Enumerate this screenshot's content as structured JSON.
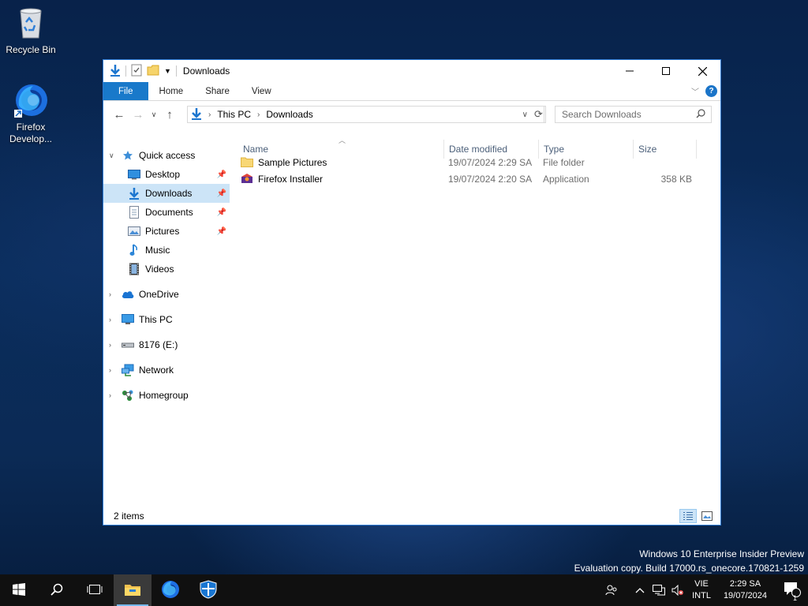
{
  "desktop": {
    "icons": [
      {
        "label": "Recycle Bin",
        "icon": "recycle-bin-icon"
      },
      {
        "label": "Firefox Develop...",
        "label_lines": [
          "Firefox",
          "Develop..."
        ],
        "icon": "firefox-developer-icon"
      }
    ],
    "watermark": {
      "line1": "Windows 10 Enterprise Insider Preview",
      "line2": "Evaluation copy. Build 17000.rs_onecore.170821-1259"
    }
  },
  "window": {
    "title": "Downloads",
    "ribbon_tabs": [
      "File",
      "Home",
      "Share",
      "View"
    ],
    "breadcrumb": [
      "This PC",
      "Downloads"
    ],
    "search_placeholder": "Search Downloads",
    "accent_color": "#1979ca",
    "sidebar": {
      "quick_access": "Quick access",
      "quick_items": [
        {
          "label": "Desktop",
          "icon": "desktop-icon",
          "pinned": true
        },
        {
          "label": "Downloads",
          "icon": "downloads-icon",
          "pinned": true,
          "selected": true
        },
        {
          "label": "Documents",
          "icon": "documents-icon",
          "pinned": true
        },
        {
          "label": "Pictures",
          "icon": "pictures-icon",
          "pinned": true
        },
        {
          "label": "Music",
          "icon": "music-icon",
          "pinned": false
        },
        {
          "label": "Videos",
          "icon": "videos-icon",
          "pinned": false
        }
      ],
      "roots": [
        {
          "label": "OneDrive",
          "icon": "onedrive-icon"
        },
        {
          "label": "This PC",
          "icon": "this-pc-icon"
        },
        {
          "label": "8176 (E:)",
          "icon": "drive-icon"
        },
        {
          "label": "Network",
          "icon": "network-icon"
        },
        {
          "label": "Homegroup",
          "icon": "homegroup-icon"
        }
      ]
    },
    "columns": [
      "Name",
      "Date modified",
      "Type",
      "Size"
    ],
    "files": [
      {
        "name": "Sample Pictures",
        "date": "19/07/2024 2:29 SA",
        "type": "File folder",
        "size": "",
        "icon": "folder-icon"
      },
      {
        "name": "Firefox Installer",
        "date": "19/07/2024 2:20 SA",
        "type": "Application",
        "size": "358 KB",
        "icon": "installer-icon"
      }
    ],
    "status": "2 items"
  },
  "taskbar": {
    "apps": [
      "start-icon",
      "search-icon",
      "task-view-icon",
      "file-explorer-icon",
      "firefox-icon",
      "windows-defender-icon"
    ],
    "lang_top": "VIE",
    "lang_bottom": "INTL",
    "time": "2:29 SA",
    "date": "19/07/2024",
    "notification_count": "1"
  }
}
